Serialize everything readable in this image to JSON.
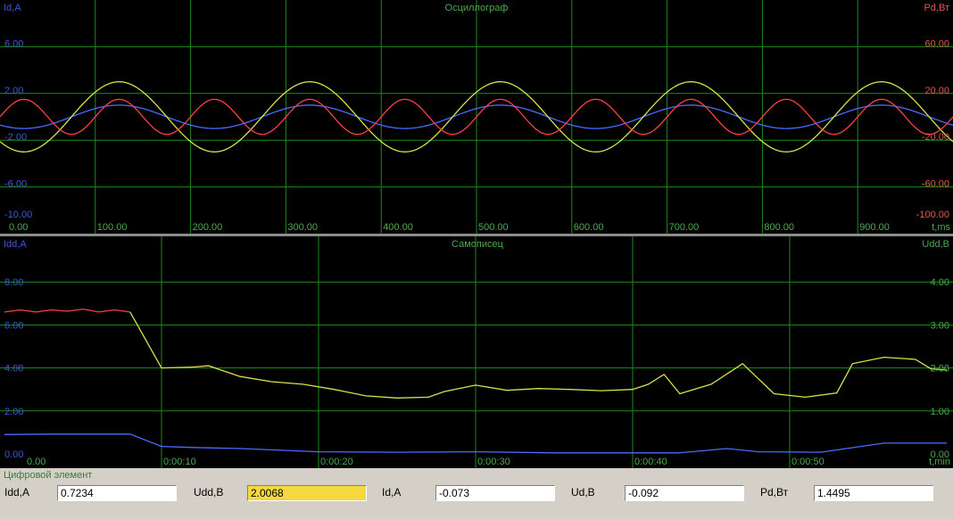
{
  "oscilloscope": {
    "title": "Осциллограф",
    "left_axis_label": "Id,A",
    "right_axis_label": "Pd,Вт",
    "time_unit": "t,ms",
    "left_ticks": [
      "6.00",
      "2.00",
      "-2.00",
      "-6.00",
      "-10.00"
    ],
    "right_ticks": [
      "60.00",
      "20.00",
      "-20.00",
      "-60.00",
      "-100.00"
    ],
    "time_ticks": [
      "0.00",
      "100.00",
      "200.00",
      "300.00",
      "400.00",
      "500.00",
      "600.00",
      "700.00",
      "800.00",
      "900.00"
    ]
  },
  "recorder": {
    "title": "Самописец",
    "left_axis_label": "Idd,A",
    "right_axis_label": "Udd,B",
    "time_unit": "t,min",
    "left_ticks": [
      "8.00",
      "6.00",
      "4.00",
      "2.00",
      "0.00"
    ],
    "right_ticks": [
      "4.00",
      "3.00",
      "2.00",
      "1.00",
      "0.00"
    ],
    "time_ticks": [
      "0.00",
      "0:00:10",
      "0:00:20",
      "0:00:30",
      "0:00:40",
      "0:00:50"
    ]
  },
  "digital": {
    "title": "Цифровой элемент",
    "fields": [
      {
        "label": "Idd,A",
        "value": "0.7234"
      },
      {
        "label": "Udd,B",
        "value": "2.0068"
      },
      {
        "label": "Id,A",
        "value": "-0.073"
      },
      {
        "label": "Ud,B",
        "value": "-0.092"
      },
      {
        "label": "Pd,Вт",
        "value": "1.4495"
      }
    ]
  },
  "colors": {
    "background": "#000000",
    "grid": "#1f8a1f",
    "left_axis_text": "#3a5ad9",
    "right_axis_text": "#e25a4a",
    "time_text": "#4caa4c",
    "trace_current": "#4a6bff",
    "trace_voltage": "#d7e34a",
    "trace_power": "#ff4040",
    "highlight_field": "#f4d83e"
  },
  "chart_data": [
    {
      "type": "line",
      "title": "Осциллограф",
      "xlabel": "t,ms",
      "ylabel": "Id,A",
      "y2label": "Pd,Вт",
      "xlim": [
        0,
        1000
      ],
      "ylim": [
        -10,
        10
      ],
      "y2lim": [
        -100,
        100
      ],
      "grid": true,
      "series": [
        {
          "axis": "left",
          "color": "#4a6bff",
          "amplitude": 1.0,
          "period_ms": 200,
          "phase_peak_ms": 125
        },
        {
          "axis": "left",
          "color": "#d7e34a",
          "amplitude": 3.0,
          "period_ms": 200,
          "phase_peak_ms": 125
        },
        {
          "axis": "right",
          "color": "#ff4040",
          "amplitude": 1.5,
          "period_ms": 100,
          "phase_peak_ms": 25
        }
      ]
    },
    {
      "type": "line",
      "title": "Самописец",
      "xlabel": "t,min",
      "ylabel": "Idd,A",
      "y2label": "Udd,B",
      "x_seconds_range": [
        0,
        60
      ],
      "ylim": [
        0,
        10
      ],
      "y2lim": [
        0,
        5
      ],
      "grid": true,
      "series": [
        {
          "axis": "right",
          "color_segments": [
            {
              "until_s": 8,
              "color": "#ff4040"
            },
            {
              "until_s": 60,
              "color": "#d7e34a"
            }
          ],
          "points": [
            [
              0,
              3.3
            ],
            [
              1,
              3.35
            ],
            [
              2,
              3.3
            ],
            [
              3,
              3.35
            ],
            [
              4,
              3.32
            ],
            [
              5,
              3.37
            ],
            [
              6,
              3.3
            ],
            [
              7,
              3.35
            ],
            [
              8,
              3.3
            ],
            [
              10,
              2.0
            ],
            [
              12,
              2.02
            ],
            [
              13,
              2.05
            ],
            [
              15,
              1.8
            ],
            [
              17,
              1.68
            ],
            [
              19,
              1.62
            ],
            [
              21,
              1.5
            ],
            [
              23,
              1.35
            ],
            [
              25,
              1.3
            ],
            [
              27,
              1.32
            ],
            [
              28,
              1.45
            ],
            [
              30,
              1.6
            ],
            [
              32,
              1.48
            ],
            [
              34,
              1.52
            ],
            [
              36,
              1.5
            ],
            [
              38,
              1.47
            ],
            [
              40,
              1.5
            ],
            [
              41,
              1.62
            ],
            [
              42,
              1.85
            ],
            [
              43,
              1.4
            ],
            [
              45,
              1.62
            ],
            [
              47,
              2.1
            ],
            [
              49,
              1.4
            ],
            [
              51,
              1.32
            ],
            [
              53,
              1.42
            ],
            [
              54,
              2.1
            ],
            [
              56,
              2.25
            ],
            [
              58,
              2.2
            ],
            [
              59,
              1.98
            ],
            [
              60,
              1.95
            ]
          ]
        },
        {
          "axis": "left",
          "color": "#4a6bff",
          "points": [
            [
              0,
              0.9
            ],
            [
              3,
              0.92
            ],
            [
              8,
              0.92
            ],
            [
              10,
              0.35
            ],
            [
              12,
              0.3
            ],
            [
              15,
              0.25
            ],
            [
              20,
              0.1
            ],
            [
              25,
              0.08
            ],
            [
              30,
              0.1
            ],
            [
              35,
              0.05
            ],
            [
              40,
              0.05
            ],
            [
              43,
              0.05
            ],
            [
              46,
              0.25
            ],
            [
              48,
              0.1
            ],
            [
              52,
              0.08
            ],
            [
              56,
              0.5
            ],
            [
              60,
              0.5
            ]
          ]
        }
      ]
    }
  ]
}
